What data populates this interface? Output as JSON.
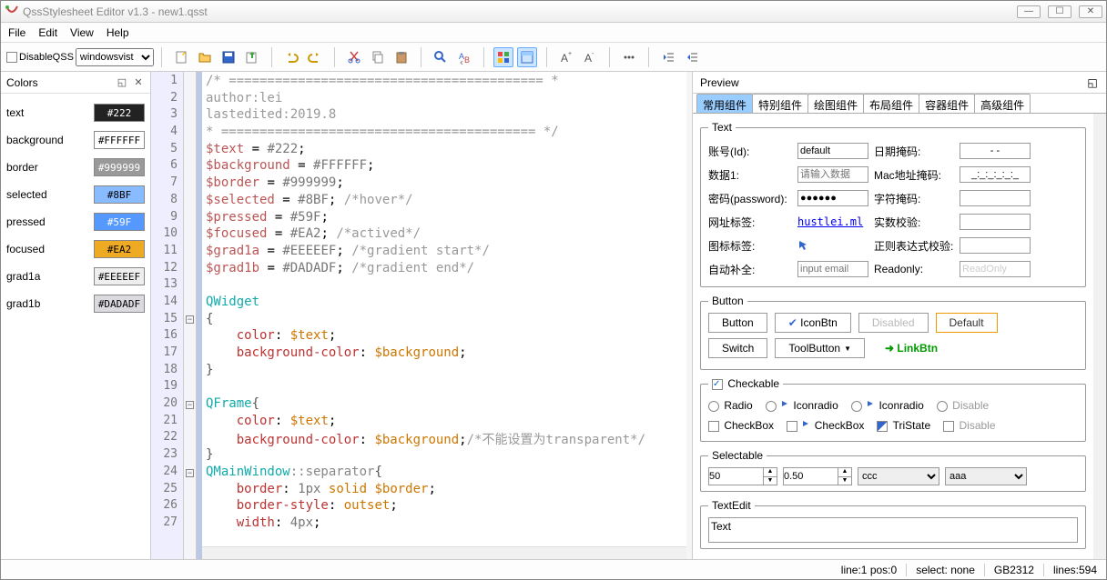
{
  "title": "QssStylesheet Editor v1.3 - new1.qsst",
  "menu": [
    "File",
    "Edit",
    "View",
    "Help"
  ],
  "toolbar": {
    "disable_label": "DisableQSS",
    "style_combo": "windowsvist"
  },
  "colors_panel": {
    "title": "Colors",
    "rows": [
      {
        "name": "text",
        "value": "#222",
        "bg": "#222222",
        "fg": "#fff"
      },
      {
        "name": "background",
        "value": "#FFFFFF",
        "bg": "#ffffff",
        "fg": "#000"
      },
      {
        "name": "border",
        "value": "#999999",
        "bg": "#999999",
        "fg": "#fff"
      },
      {
        "name": "selected",
        "value": "#8BF",
        "bg": "#88bbff",
        "fg": "#000"
      },
      {
        "name": "pressed",
        "value": "#59F",
        "bg": "#5599ff",
        "fg": "#fff"
      },
      {
        "name": "focused",
        "value": "#EA2",
        "bg": "#eeaa22",
        "fg": "#000"
      },
      {
        "name": "grad1a",
        "value": "#EEEEEF",
        "bg": "#eeeeef",
        "fg": "#000"
      },
      {
        "name": "grad1b",
        "value": "#DADADF",
        "bg": "#dadadf",
        "fg": "#000"
      }
    ]
  },
  "code_lines": [
    {
      "n": 1,
      "html": "<span class='c-comment'>/* ========================================= *</span>"
    },
    {
      "n": 2,
      "html": "<span class='c-comment'>author:lei</span>"
    },
    {
      "n": 3,
      "html": "<span class='c-comment'>lastedited:2019.8</span>"
    },
    {
      "n": 4,
      "html": "<span class='c-comment'>* ========================================= */</span>"
    },
    {
      "n": 5,
      "html": "<span class='c-var'>$text</span> = <span class='c-hex'>#222</span>;"
    },
    {
      "n": 6,
      "html": "<span class='c-var'>$background</span> = <span class='c-hex'>#FFFFFF</span>;"
    },
    {
      "n": 7,
      "html": "<span class='c-var'>$border</span> = <span class='c-hex'>#999999</span>;"
    },
    {
      "n": 8,
      "html": "<span class='c-var'>$selected</span> = <span class='c-hex'>#8BF</span>; <span class='c-comment'>/*hover*/</span>"
    },
    {
      "n": 9,
      "html": "<span class='c-var'>$pressed</span> = <span class='c-hex'>#59F</span>;"
    },
    {
      "n": 10,
      "html": "<span class='c-var'>$focused</span> = <span class='c-hex'>#EA2</span>; <span class='c-comment'>/*actived*/</span>"
    },
    {
      "n": 11,
      "html": "<span class='c-var'>$grad1a</span> = <span class='c-hex'>#EEEEEF</span>; <span class='c-comment'>/*gradient start*/</span>"
    },
    {
      "n": 12,
      "html": "<span class='c-var'>$grad1b</span> = <span class='c-hex'>#DADADF</span>; <span class='c-comment'>/*gradient end*/</span>"
    },
    {
      "n": 13,
      "html": ""
    },
    {
      "n": 14,
      "html": "<span class='c-widget'>QWidget</span>"
    },
    {
      "n": 15,
      "html": "<span class='c-punc'>{</span>",
      "fold": "-"
    },
    {
      "n": 16,
      "html": "    <span class='c-prop'>color</span>: <span class='c-val'>$text</span>;"
    },
    {
      "n": 17,
      "html": "    <span class='c-prop'>background-color</span>: <span class='c-val'>$background</span>;"
    },
    {
      "n": 18,
      "html": "<span class='c-punc'>}</span>"
    },
    {
      "n": 19,
      "html": ""
    },
    {
      "n": 20,
      "html": "<span class='c-widget'>QFrame</span><span class='c-punc'>{</span>",
      "fold": "-"
    },
    {
      "n": 21,
      "html": "    <span class='c-prop'>color</span>: <span class='c-val'>$text</span>;"
    },
    {
      "n": 22,
      "html": "    <span class='c-prop'>background-color</span>: <span class='c-val'>$background</span>;<span class='c-comment'>/*不能设置为transparent*/</span>"
    },
    {
      "n": 23,
      "html": "<span class='c-punc'>}</span>"
    },
    {
      "n": 24,
      "html": "<span class='c-widget'>QMainWindow</span><span class='c-pseudo'>::separator</span><span class='c-punc'>{</span>",
      "fold": "-"
    },
    {
      "n": 25,
      "html": "    <span class='c-prop'>border</span>: <span class='c-hex'>1px</span> <span class='c-val'>solid $border</span>;"
    },
    {
      "n": 26,
      "html": "    <span class='c-prop'>border-style</span>: <span class='c-val'>outset</span>;"
    },
    {
      "n": 27,
      "html": "    <span class='c-prop'>width</span>: <span class='c-hex'>4px</span>;"
    }
  ],
  "preview": {
    "title": "Preview",
    "tabs": [
      "常用组件",
      "特别组件",
      "绘图组件",
      "布局组件",
      "容器组件",
      "高级组件"
    ],
    "text_group": {
      "legend": "Text",
      "id_label": "账号(Id):",
      "id_value": "default",
      "data1_label": "数据1:",
      "data1_placeholder": "请输入数据",
      "pwd_label": "密码(password):",
      "pwd_value": "●●●●●●",
      "url_label": "网址标签:",
      "url_link": "hustlei.ml",
      "icon_label": "图标标签:",
      "auto_label": "自动补全:",
      "auto_placeholder": "input email",
      "date_label": "日期掩码:",
      "date_value": "- -",
      "mac_label": "Mac地址掩码:",
      "mac_value": "_:_:_:_:_:_",
      "char_label": "字符掩码:",
      "real_label": "实数校验:",
      "regex_label": "正则表达式校验:",
      "ro_label": "Readonly:",
      "ro_value": "ReadOnly"
    },
    "button_group": {
      "legend": "Button",
      "btn1": "Button",
      "btn2": "IconBtn",
      "btn3": "Disabled",
      "btn4": "Default",
      "switch": "Switch",
      "toolbtn": "ToolButton",
      "linkbtn": "LinkBtn"
    },
    "check_group": {
      "legend": "Checkable",
      "radio": "Radio",
      "iconradio": "Iconradio",
      "disable_r": "Disable",
      "checkbox": "CheckBox",
      "tristate": "TriState",
      "disable_c": "Disable"
    },
    "select_group": {
      "legend": "Selectable",
      "spin1": "50",
      "spin2": "0.50",
      "combo1": "ccc",
      "combo2": "aaa"
    },
    "textedit_group": {
      "legend": "TextEdit",
      "content": "Text"
    }
  },
  "status": {
    "linepos": "line:1  pos:0",
    "select": "select: none",
    "coding": "GB2312",
    "lines": "lines:594"
  }
}
